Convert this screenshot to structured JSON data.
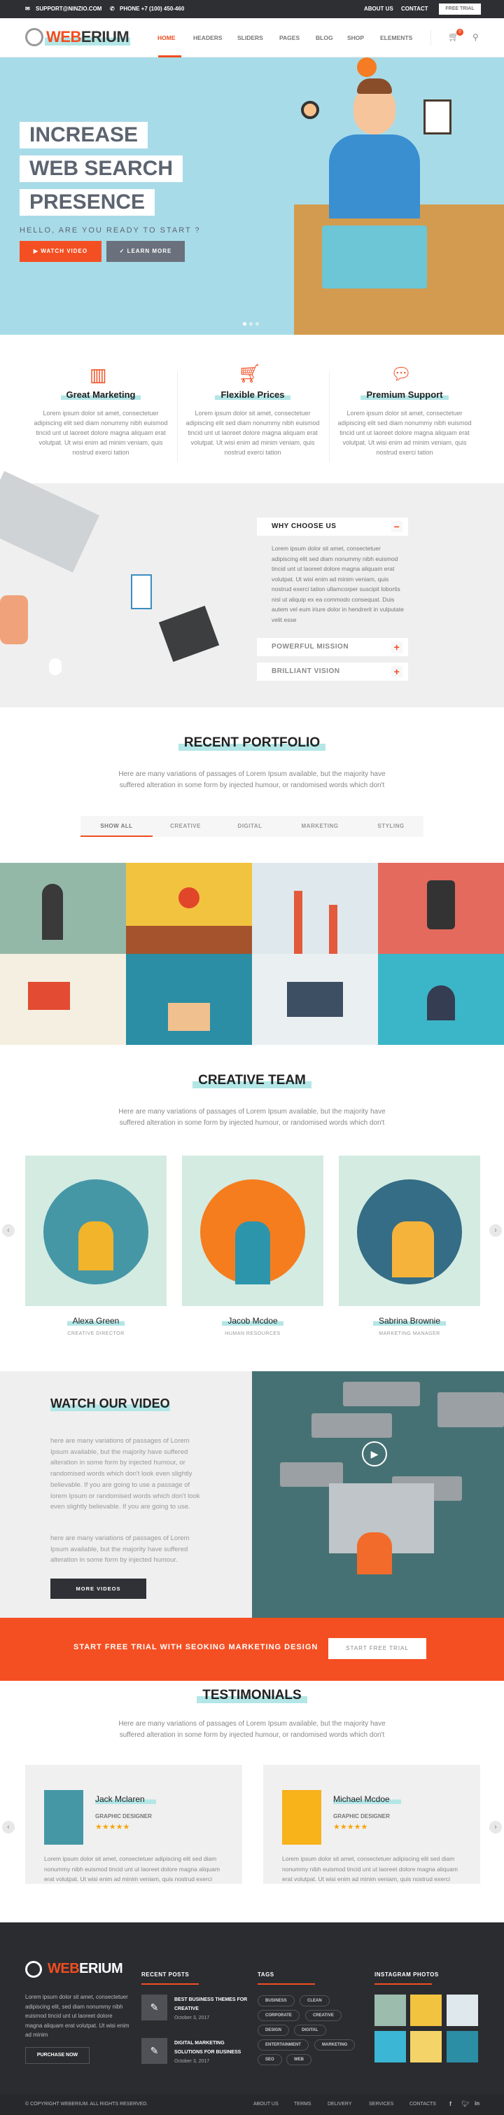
{
  "topbar": {
    "email": "SUPPORT@NINZIO.COM",
    "phone": "PHONE +7 (100) 450-460",
    "links": [
      "ABOUT US",
      "CONTACT"
    ],
    "free_trial": "FREE TRIAL"
  },
  "nav": {
    "logo_accent": "WEB",
    "logo_rest": "ERIUM",
    "items": [
      "HOME",
      "HEADERS",
      "SLIDERS",
      "PAGES",
      "BLOG",
      "SHOP",
      "ELEMENTS"
    ],
    "active": "HOME",
    "cart_count": "0"
  },
  "hero": {
    "lines": [
      "INCREASE",
      "WEB SEARCH",
      "PRESENCE"
    ],
    "subtitle": "HELLO, ARE YOU READY TO START ?",
    "watch": "WATCH VIDEO",
    "learn": "LEARN MORE",
    "slides": 3,
    "active_slide": 1
  },
  "features": [
    {
      "title": "Great Marketing",
      "icon": "bar-chart-icon",
      "text": "Lorem ipsum dolor sit amet, consectetuer adipiscing elit sed diam nonummy nibh euismod tincid unt ut laoreet dolore magna aliquam erat volutpat. Ut wisi enim ad minim veniam, quis nostrud exerci tation"
    },
    {
      "title": "Flexible Prices",
      "icon": "cart-icon",
      "text": "Lorem ipsum dolor sit amet, consectetuer adipiscing elit sed diam nonummy nibh euismod tincid unt ut laoreet dolore magna aliquam erat volutpat. Ut wisi enim ad minim veniam, quis nostrud exerci tation"
    },
    {
      "title": "Premium Support",
      "icon": "chat-icon",
      "text": "Lorem ipsum dolor sit amet, consectetuer adipiscing elit sed diam nonummy nibh euismod tincid unt ut laoreet dolore magna aliquam erat volutpat. Ut wisi enim ad minim veniam, quis nostrud exerci tation"
    }
  ],
  "accordion": [
    {
      "title": "WHY CHOOSE US",
      "open": true,
      "text": "Lorem ipsum dolor sit amet, consectetuer adipiscing elit sed diam nonummy nibh euismod tincid unt ut laoreet dolore magna aliquam erat volutpat. Ut wisi enim ad minim veniam, quis nostrud exerci tation ullamcorper suscipit lobortis nisl ut aliquip ex ea commodo consequat. Duis autem vel eum iriure dolor in hendrerit in vulputate velit esse"
    },
    {
      "title": "POWERFUL MISSION",
      "open": false
    },
    {
      "title": "BRILLIANT VISION",
      "open": false
    }
  ],
  "portfolio": {
    "title": "RECENT PORTFOLIO",
    "text": "Here are many variations of passages of Lorem Ipsum available, but the majority have suffered alteration in some form by injected humour, or randomised words which don't",
    "tabs": [
      "SHOW ALL",
      "CREATIVE",
      "DIGITAL",
      "MARKETING",
      "STYLING"
    ],
    "active_tab": "SHOW ALL"
  },
  "team": {
    "title": "CREATIVE TEAM",
    "text": "Here are many variations of passages of Lorem Ipsum available, but the majority have suffered alteration in some form by injected humour, or randomised words which don't",
    "members": [
      {
        "name": "Alexa Green",
        "role": "CREATIVE DIRECTOR"
      },
      {
        "name": "Jacob Mcdoe",
        "role": "HUMAN RESOURCES"
      },
      {
        "name": "Sabrina Brownie",
        "role": "MARKETING MANAGER"
      }
    ]
  },
  "video": {
    "title": "WATCH OUR VIDEO",
    "p1": "here are many variations of passages of Lorem Ipsum available, but the majority have suffered alteration in some form by injected humour, or randomised words which don't look even slightly believable. If you are going to use a passage of lorem Ipsum or randomised words which don't look even slightly believable. If you are going to use.",
    "p2": "here are many variations of passages of Lorem Ipsum available, but the majority have suffered alteration in some form by injected humour.",
    "button": "MORE VIDEOS"
  },
  "cta": {
    "text": "START FREE TRIAL WITH SEOKING MARKETING DESIGN",
    "button": "START FREE TRIAL"
  },
  "testimonials": {
    "title": "TESTIMONIALS",
    "text": "Here are many variations of passages of Lorem Ipsum available, but the majority have suffered alteration in some form by injected humour, or randomised words which don't",
    "items": [
      {
        "name": "Jack Mclaren",
        "role": "GRAPHIC DESIGNER",
        "rating": 5,
        "text": "Lorem ipsum dolor sit amet, consectetuer adipiscing elit sed diam nonummy nibh euismod tincid unt ut laoreet dolore magna aliquam erat volutpat. Ut wisi enim ad minim veniam, quis nostrud exerci"
      },
      {
        "name": "Michael Mcdoe",
        "role": "GRAPHIC DESIGNER",
        "rating": 5,
        "text": "Lorem ipsum dolor sit amet, consectetuer adipiscing elit sed diam nonummy nibh euismod tincid unt ut laoreet dolore magna aliquam erat volutpat. Ut wisi enim ad minim veniam, quis nostrud exerci"
      }
    ]
  },
  "footer": {
    "about": "Lorem ipsum dolor sit amet, consectetuer adipiscing elit, sed diam nonummy nibh euismod tincid unt ut laoreet dolore magna aliquam erat volutpat. Ut wisi enim ad minim",
    "purchase": "PURCHASE NOW",
    "recent_title": "RECENT POSTS",
    "posts": [
      {
        "title": "BEST BUSINESS THEMES FOR CREATIVE",
        "date": "October 3, 2017"
      },
      {
        "title": "DIGITAL MARKETING SOLUTIONS FOR BUSINESS",
        "date": "October 3, 2017"
      }
    ],
    "tags_title": "TAGS",
    "tags": [
      "BUSINESS",
      "CLEAN",
      "CORPORATE",
      "CREATIVE",
      "DESIGN",
      "DIGITAL",
      "ENTERTAINMENT",
      "MARKETING",
      "SEO",
      "WEB"
    ],
    "insta_title": "INSTAGRAM PHOTOS",
    "copyright": "© COPYRIGHT WEBERIUM. ALL RIGHTS RESERVED.",
    "links": [
      "ABOUT US",
      "TERMS",
      "DELIVERY",
      "SERVICES",
      "CONTACTS"
    ],
    "social": [
      "facebook-icon",
      "twitter-icon",
      "linkedin-icon"
    ]
  },
  "colors": {
    "accent": "#f14d20",
    "highlight": "#b3e6e6",
    "dark": "#2d2f33"
  }
}
